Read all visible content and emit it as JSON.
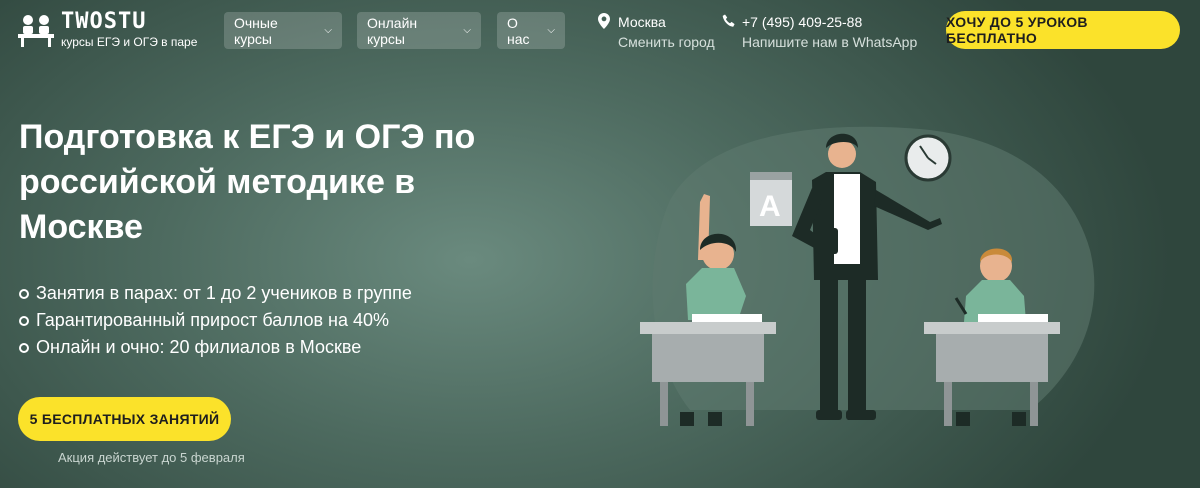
{
  "logo": {
    "title": "TWOSTU",
    "subtitle": "курсы ЕГЭ и ОГЭ в паре"
  },
  "nav": [
    {
      "label": "Очные курсы"
    },
    {
      "label": "Онлайн курсы"
    },
    {
      "label": "О нас"
    }
  ],
  "location": {
    "city": "Москва",
    "change": "Сменить город"
  },
  "phone": {
    "number": "+7 (495) 409-25-88",
    "whatsapp": "Напишите нам в WhatsApp"
  },
  "header_cta": "ХОЧУ ДО 5 УРОКОВ БЕСПЛАТНО",
  "hero": {
    "title": "Подготовка к ЕГЭ и ОГЭ по российской методике в Москве",
    "features": [
      "Занятия в парах: от 1 до 2 учеников в группе",
      "Гарантированный прирост баллов на 40%",
      "Онлайн и очно: 20 филиалов в Москве"
    ],
    "cta": "5 БЕСПЛАТНЫХ ЗАНЯТИЙ",
    "promo": "Акция действует до 5 февраля",
    "board_letter": "A"
  },
  "colors": {
    "accent": "#fbe22a",
    "bg_dark": "#2f463d",
    "bg_light": "#6a8a7e"
  }
}
